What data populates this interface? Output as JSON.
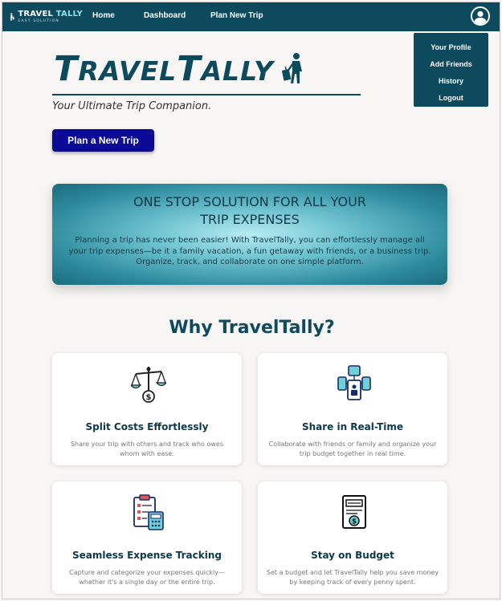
{
  "navbar": {
    "logo": {
      "title_main": "TRAVEL",
      "title_accent": "TALLY",
      "subtitle": "EASY SOLUTION"
    },
    "links": [
      "Home",
      "Dashboard",
      "Plan New Trip"
    ],
    "avatar_icon": "user-circle-icon"
  },
  "profile_menu": {
    "items": [
      "Your Profile",
      "Add Friends",
      "History",
      "Logout"
    ]
  },
  "hero": {
    "brand_first": "T",
    "brand_rest1": "RAVEL",
    "brand_second": "T",
    "brand_rest2": "ALLY",
    "tagline": "Your Ultimate Trip Companion.",
    "cta_label": "Plan a New Trip",
    "brand_icon": "traveler-with-suitcase-icon"
  },
  "banner": {
    "title": "ONE STOP SOLUTION FOR ALL YOUR TRIP EXPENSES",
    "text": "Planning a trip has never been easier! With TravelTally, you can effortlessly manage all your trip expenses—be it a family vacation, a fun getaway with friends, or a business trip. Organize, track, and collaborate on one simple platform."
  },
  "why": {
    "title": "Why TravelTally?",
    "cards": [
      {
        "icon": "balance-scale-dollar-icon",
        "title": "Split Costs Effortlessly",
        "desc": "Share your trip with others and track who owes whom with ease."
      },
      {
        "icon": "shared-devices-icon",
        "title": "Share in Real-Time",
        "desc": "Collaborate with friends or family and organize your trip budget together in real time."
      },
      {
        "icon": "clipboard-calculator-icon",
        "title": "Seamless Expense Tracking",
        "desc": "Capture and categorize your expenses quickly—whether it's a single day or the entire trip."
      },
      {
        "icon": "budget-document-icon",
        "title": "Stay on Budget",
        "desc": "Set a budget and let TravelTally help you save money by keeping track of every penny spent."
      }
    ]
  },
  "colors": {
    "primary": "#0d4a5e",
    "cta": "#0a0a96",
    "background": "#f7f6f5"
  }
}
